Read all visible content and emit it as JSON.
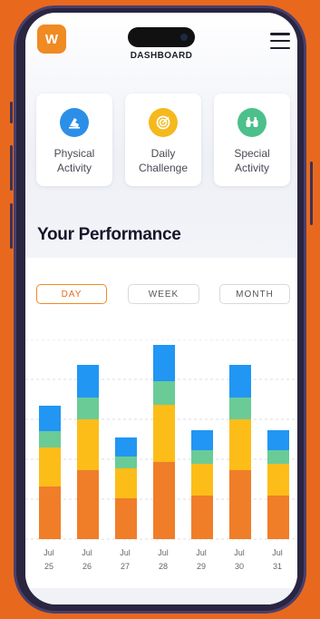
{
  "header": {
    "logo_letter": "W",
    "title": "DASHBOARD",
    "menu_icon": "hamburger-menu-icon"
  },
  "activities": [
    {
      "label": "Physical\nActivity",
      "icon": "running-shoe-icon",
      "color": "#2B8FE8"
    },
    {
      "label": "Daily\nChallenge",
      "icon": "target-icon",
      "color": "#F5B91D"
    },
    {
      "label": "Special\nActivity",
      "icon": "binoculars-icon",
      "color": "#4CC08A"
    }
  ],
  "performance_title": "Your Performance",
  "tabs": [
    {
      "label": "DAY",
      "active": true
    },
    {
      "label": "WEEK",
      "active": false
    },
    {
      "label": "MONTH",
      "active": false
    }
  ],
  "chart_data": {
    "type": "bar",
    "stacked": true,
    "categories": [
      "Jul 25",
      "Jul 26",
      "Jul 27",
      "Jul 28",
      "Jul 29",
      "Jul 30",
      "Jul 31"
    ],
    "x_month": [
      "Jul",
      "Jul",
      "Jul",
      "Jul",
      "Jul",
      "Jul",
      "Jul"
    ],
    "x_day": [
      "25",
      "26",
      "27",
      "28",
      "29",
      "30",
      "31"
    ],
    "series": [
      {
        "color": "#F07D28",
        "values": [
          58,
          76,
          45,
          85,
          48,
          76,
          48
        ]
      },
      {
        "color": "#FDBD19",
        "values": [
          43,
          56,
          33,
          63,
          35,
          56,
          35
        ]
      },
      {
        "color": "#6ACB96",
        "values": [
          18,
          24,
          13,
          26,
          15,
          24,
          15
        ]
      },
      {
        "color": "#2196F3",
        "values": [
          28,
          36,
          21,
          40,
          22,
          36,
          22
        ]
      }
    ],
    "ylim": [
      0,
      220
    ],
    "grid": true
  }
}
